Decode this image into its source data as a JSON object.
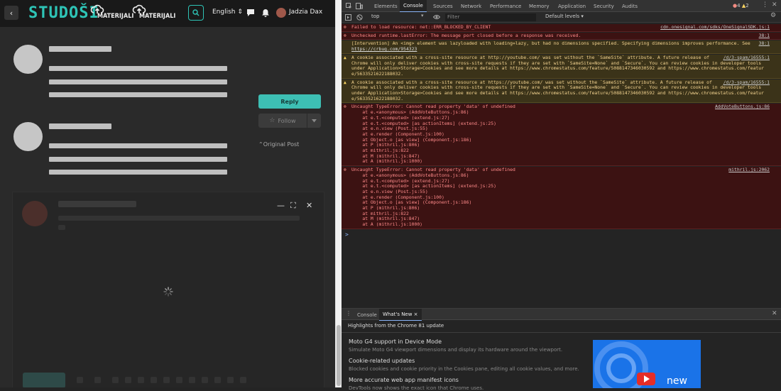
{
  "site": {
    "logo": "STUDOŠI",
    "nav": [
      "MATERIJALI",
      "MATERIJALI"
    ],
    "language": "English",
    "user_name": "Jadzia Dax"
  },
  "post_actions": {
    "reply": "Reply",
    "follow": "Follow",
    "original_post": "Original Post"
  },
  "devtools": {
    "tabs": [
      "Elements",
      "Console",
      "Sources",
      "Network",
      "Performance",
      "Memory",
      "Application",
      "Security",
      "Audits"
    ],
    "error_count": "4",
    "warning_count": "2",
    "context": "top",
    "filter_placeholder": "Filter",
    "levels": "Default levels ▾",
    "messages": [
      {
        "type": "error",
        "text": "Failed to load resource: net::ERR_BLOCKED_BY_CLIENT",
        "source": "cdn.onesignal.com/sdks/OneSignalSDK.js:1"
      },
      {
        "type": "error",
        "text": "Unchecked runtime.lastError: The message port closed before a response was received.",
        "source": "38:1"
      },
      {
        "type": "warn-plain",
        "text": "[Intervention] An <img> element was lazyloaded with loading=lazy, but had no dimensions specified. Specifying dimensions improves performance. See",
        "link": "https://crbug.com/954323",
        "source": "38:1"
      },
      {
        "type": "warn",
        "lines": [
          "A cookie associated with a cross-site resource at http://youtube.com/ was set without the `SameSite` attribute. A future release of",
          "Chrome will only deliver cookies with cross-site requests if they are set with `SameSite=None` and `Secure`. You can review cookies in developer tools",
          "under Application>Storage>Cookies and see more details at https://www.chromestatus.com/feature/5088147346030592 and https://www.chromestatus.com/featur",
          "e/5633521622188032."
        ],
        "source": "/d/3-spam/16555:1"
      },
      {
        "type": "warn",
        "lines": [
          "A cookie associated with a cross-site resource at https://youtube.com/ was set without the `SameSite` attribute. A future release of",
          "Chrome will only deliver cookies with cross-site requests if they are set with `SameSite=None` and `Secure`. You can review cookies in developer tools",
          "under Application>Storage>Cookies and see more details at https://www.chromestatus.com/feature/5088147346030592 and https://www.chromestatus.com/featur",
          "e/5633521622188032."
        ],
        "source": "/d/3-spam/16555:1"
      },
      {
        "type": "error-trace",
        "lines": [
          "Uncaught TypeError: Cannot read property 'data' of undefined",
          "    at e.<anonymous> (AddVoteButtons.js:86)",
          "    at e.t.<computed> (extend.js:27)",
          "    at e.t.<computed> [as actionItems] (extend.js:25)",
          "    at e.n.view (Post.js:55)",
          "    at e.render (Component.js:100)",
          "    at Object.o [as view] (Component.js:186)",
          "    at P (mithril.js:806)",
          "    at mithril.js:822",
          "    at M (mithril.js:847)",
          "    at A (mithril.js:1000)"
        ],
        "source": "AddVoteButtons.js:86"
      },
      {
        "type": "error-trace",
        "lines": [
          "Uncaught TypeError: Cannot read property 'data' of undefined",
          "    at e.<anonymous> (AddVoteButtons.js:86)",
          "    at e.t.<computed> (extend.js:27)",
          "    at e.t.<computed> [as actionItems] (extend.js:25)",
          "    at e.n.view (Post.js:55)",
          "    at e.render (Component.js:100)",
          "    at Object.o [as view] (Component.js:186)",
          "    at P (mithril.js:806)",
          "    at mithril.js:822",
          "    at M (mithril.js:847)",
          "    at A (mithril.js:1000)"
        ],
        "source": "mithril.js:2062"
      }
    ],
    "prompt": ">",
    "drawer_tabs": [
      "Console",
      "What's New ×"
    ],
    "whats_new_header": "Highlights from the Chrome 81 update",
    "whats_new": [
      {
        "title": "Moto G4 support in Device Mode",
        "desc": "Simulate Moto G4 viewport dimensions and display its hardware around the viewport."
      },
      {
        "title": "Cookie-related updates",
        "desc": "Blocked cookies and cookie priority in the Cookies pane, editing all cookie values, and more."
      },
      {
        "title": "More accurate web app manifest icons",
        "desc": "DevTools now shows the exact icon that Chrome uses."
      }
    ],
    "promo_text": "new"
  },
  "colors": {
    "accent": "#2ec4b6",
    "error_bg": "#3c1212",
    "warn_bg": "#3b3319"
  }
}
